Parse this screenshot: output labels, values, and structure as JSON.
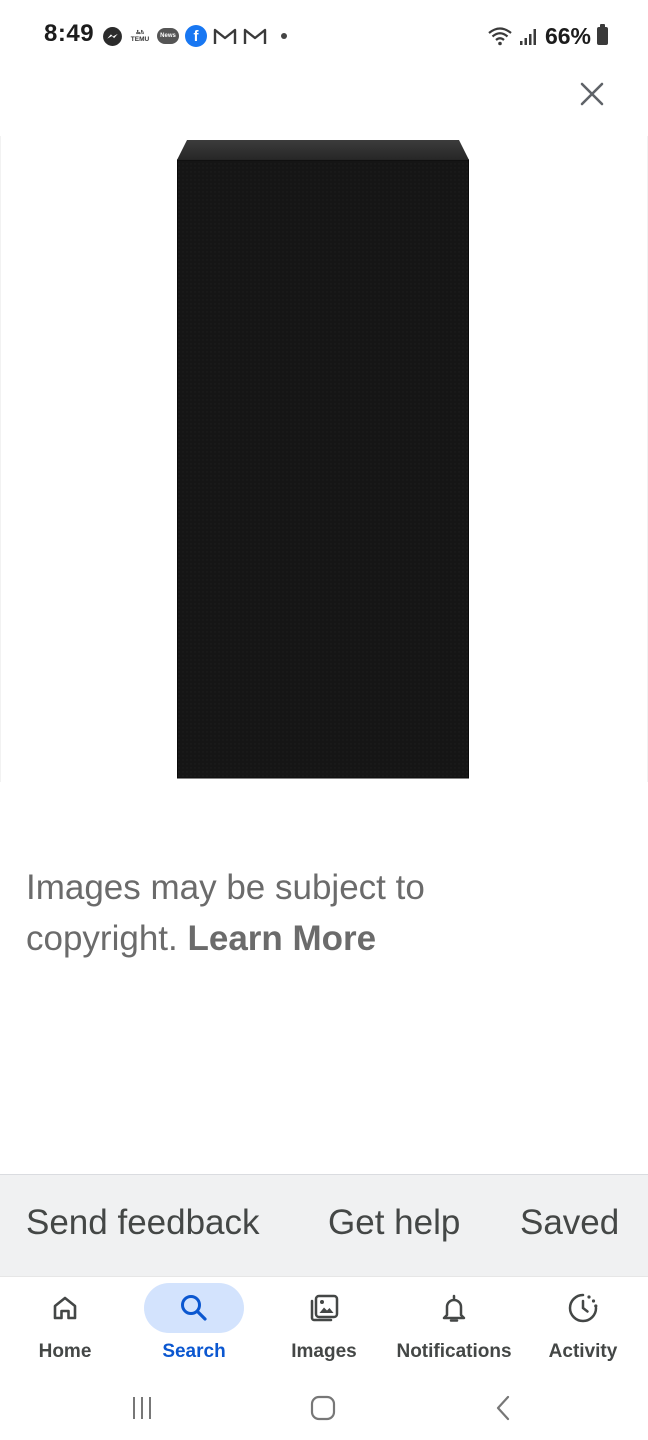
{
  "status_bar": {
    "time": "8:49",
    "temu_label_top": "ಹಿಸಿ",
    "temu_label_bottom": "TEMU",
    "news_label": "News",
    "facebook_glyph": "f",
    "battery": "66%",
    "left_icons": [
      "messenger-icon",
      "temu-icon",
      "news-icon",
      "facebook-icon",
      "gmail-icon",
      "gmail-icon",
      "dot-icon"
    ],
    "right_icons": [
      "wifi-icon",
      "signal-icon",
      "battery-icon"
    ]
  },
  "viewer": {
    "close_icon": "close-icon",
    "image_subject": "speaker"
  },
  "copyright": {
    "text": "Images may be subject to copyright.",
    "link": "Learn More"
  },
  "footer": {
    "send_feedback": "Send feedback",
    "get_help": "Get help",
    "saved": "Saved"
  },
  "bottom_nav": {
    "items": [
      {
        "label": "Home",
        "icon": "home-icon",
        "active": false
      },
      {
        "label": "Search",
        "icon": "search-icon",
        "active": true
      },
      {
        "label": "Images",
        "icon": "images-icon",
        "active": false
      },
      {
        "label": "Notifications",
        "icon": "bell-icon",
        "active": false
      },
      {
        "label": "Activity",
        "icon": "activity-icon",
        "active": false
      }
    ]
  },
  "system_nav": [
    "recent-apps-icon",
    "home-circle-icon",
    "back-icon"
  ],
  "colors": {
    "accent": "#0b57d0",
    "active_pill": "#d3e3fd",
    "footer_bg": "#f0f1f2",
    "text_muted": "#6b6b6b",
    "speaker_body": "#141414"
  }
}
